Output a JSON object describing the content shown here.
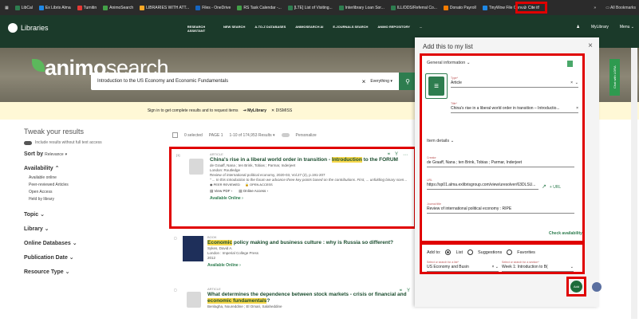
{
  "bookmarks": {
    "items": [
      {
        "label": "LibCal",
        "color": "#2e7d4f"
      },
      {
        "label": "Ex Libris Alma",
        "color": "#1e88e5"
      },
      {
        "label": "Turnitin",
        "color": "#e53935"
      },
      {
        "label": "AnimoSearch",
        "color": "#43a047"
      },
      {
        "label": "LIBRARIES WITH ATT...",
        "color": "#f9a825"
      },
      {
        "label": "Files - OneDrive",
        "color": "#1565c0"
      },
      {
        "label": "RS Task Calendar -...",
        "color": "#43a047"
      },
      {
        "label": "[LTE] List of Visiting...",
        "color": "#2e7d4f"
      },
      {
        "label": "Interlibrary Loan Sor...",
        "color": "#2e7d4f"
      },
      {
        "label": "ILL/DDS/Referral Co...",
        "color": "#2e7d4f"
      },
      {
        "label": "Donato Payroll",
        "color": "#f57c00"
      },
      {
        "label": "TinyWow File Conv...",
        "color": "#1e88e5"
      }
    ],
    "cite_it": "Cite it!",
    "more": "»",
    "all_bookmarks": "All Bookmarks"
  },
  "header": {
    "logo": "Libraries",
    "nav": [
      "RESEARCH ASSISTANT",
      "NEW SEARCH",
      "A-TO-Z DATABASES",
      "ANIMOSEARCH AI",
      "E-JOURNALS SEARCH",
      "ANIMO REPOSITORY",
      "..."
    ],
    "mylibrary": "MyLibrary",
    "menu": "Menu"
  },
  "hero": {
    "brand_bold": "animo",
    "brand_light": "search",
    "query": "Introduction to the US Economy and Economic Fundamentals",
    "scope": "Everything"
  },
  "signin": {
    "text": "Sign in to get complete results and to request items",
    "link": "MyLibrary",
    "dismiss": "DISMISS"
  },
  "facets": {
    "tweak": "Tweak your results",
    "fulltext": "Include results without full text access",
    "sort_label": "Sort by",
    "sort_value": "Relevance",
    "availability": "Availability",
    "availability_items": [
      "Available online",
      "Peer-reviewed Articles",
      "Open Access",
      "Held by library"
    ],
    "groups": [
      "Topic",
      "Library",
      "Online Databases",
      "Publication Date",
      "Resource Type"
    ]
  },
  "results_bar": {
    "selected": "0 selected",
    "page": "PAGE 1",
    "count": "1-10 of 174,953 Results",
    "personalize": "Personalize"
  },
  "results": [
    {
      "num": "[1]",
      "type": "ARTICLE",
      "title_pre": "China's rise in a liberal world order in transition - ",
      "title_hl": "Introduction",
      "title_post": " to the FORUM",
      "authors": "de Graaff, Nana ; ten Brink, Tobias ; Parmar, Inderjeet",
      "publisher": "London: Routledge",
      "source": "Review of international political economy, 2020-03, Vol.27 (2), p.191-207",
      "snippet": "\" ... In this introduction to the forum we advance three key points based on the contributions. First, ... unfolding binary scenarios of either inevitable conflict or co...\"",
      "badges": [
        "PEER REVIEWED",
        "OPEN ACCESS"
      ],
      "links": [
        "View PDF",
        "Online Access"
      ],
      "avail": "Available Online"
    },
    {
      "type": "BOOK",
      "title_hl": "Economic",
      "title_post": " policy making and business culture : why is Russia so different?",
      "authors": "Sykes, David A.",
      "publisher": "London : Imperial College Press",
      "year": "2012",
      "avail": "Available Online"
    },
    {
      "type": "ARTICLE",
      "title_pre": "What determines the dependence between stock markets - crisis or financial and ",
      "title_hl": "economic fundamentals",
      "title_post": "?",
      "authors": "Benlagha, Noureddine ; El Omari, Salaheddine"
    }
  ],
  "panel": {
    "title": "Add this to my list",
    "general_info": "General information",
    "type_label": "Type*",
    "type_value": "Article",
    "title_label": "Title*",
    "title_value": "China's rise in a liberal world order in transition – Introductio...",
    "item_details": "Item details",
    "creator_label": "Creator",
    "creator_value": "de Graaff, Nana ; ten Brink, Tobias ; Parmar, Inderjeet",
    "url_label": "URL",
    "url_value": "https://sp01.alma.exlibrisgroup.com/view/uresolver/63DLSU...",
    "url_action": "URL",
    "journal_label": "Journal title",
    "journal_value": "Review of international political economy : RIPE",
    "check_availability": "Check availability",
    "add_to": "Add to:",
    "opt_list": "List",
    "opt_suggestions": "Suggestions",
    "opt_favorites": "Favorites",
    "list_label": "Select or search for a list*",
    "list_value": "US Economy and Busin",
    "section_label": "Select or search for a section*",
    "section_value": "Week 1: Introduction to B(",
    "add_button": "Add"
  },
  "chat_tab": "Chat with LORA"
}
